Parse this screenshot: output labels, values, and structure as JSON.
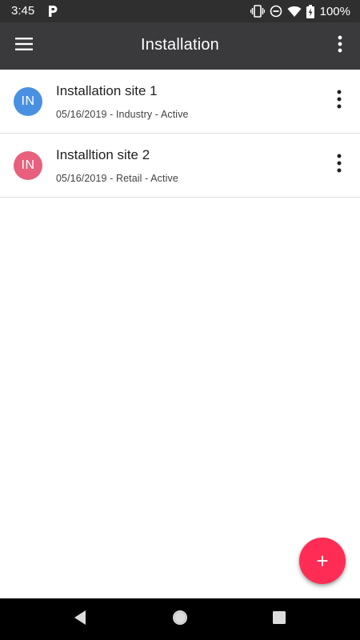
{
  "status_bar": {
    "time": "3:45",
    "battery": "100%",
    "icons": [
      "parking-app-icon",
      "vibrate-icon",
      "do-not-disturb-icon",
      "wifi-icon",
      "battery-charging-icon"
    ]
  },
  "app_bar": {
    "title": "Installation",
    "menu_icon": "hamburger-menu-icon",
    "overflow_icon": "more-vert-icon"
  },
  "sites": [
    {
      "avatar": "IN",
      "avatar_color": "#4a90e2",
      "title": "Installation site 1",
      "subtitle": "05/16/2019 - Industry - Active"
    },
    {
      "avatar": "IN",
      "avatar_color": "#e8607e",
      "title": "Installtion site 2",
      "subtitle": "05/16/2019 - Retail - Active"
    }
  ],
  "fab": {
    "label": "+",
    "color": "#ff2d55"
  },
  "nav_bar": {
    "icons": [
      "back-icon",
      "home-icon",
      "recents-icon"
    ]
  }
}
